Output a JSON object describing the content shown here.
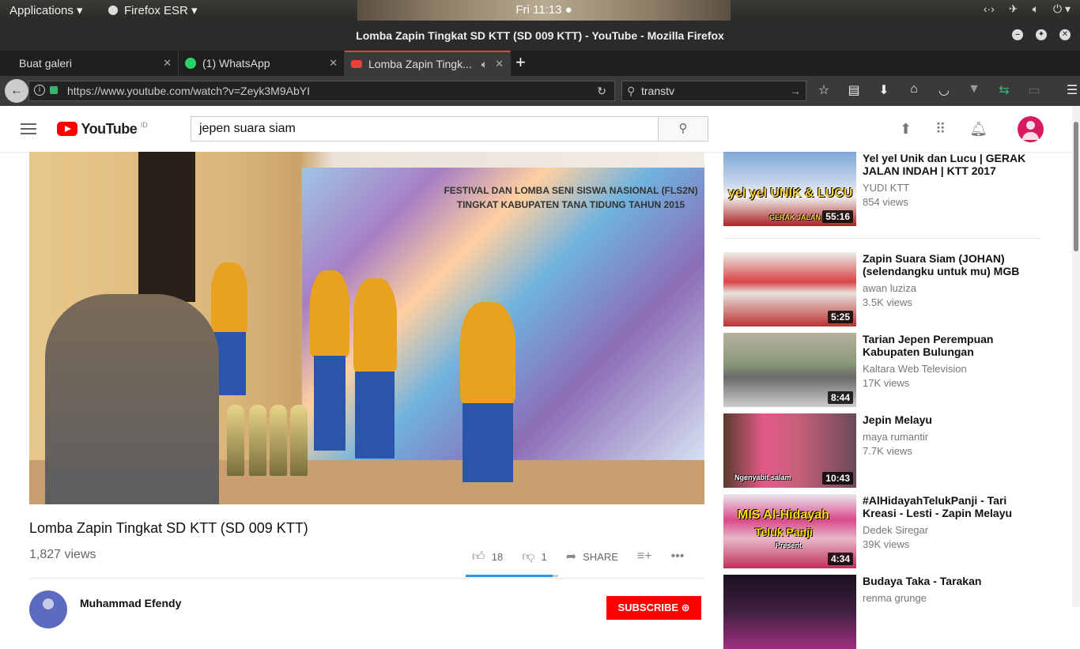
{
  "desktop": {
    "applications": "Applications",
    "app_name": "Firefox ESR",
    "clock": "Fri 11:13"
  },
  "window": {
    "title": "Lomba Zapin Tingkat SD KTT (SD 009 KTT) - YouTube - Mozilla Firefox"
  },
  "tabs": [
    {
      "label": "Buat galeri"
    },
    {
      "label": "(1) WhatsApp"
    },
    {
      "label": "Lomba Zapin Tingk..."
    }
  ],
  "nav": {
    "url": "https://www.youtube.com/watch?v=Zeyk3M9AbYI",
    "search_value": "transtv"
  },
  "youtube": {
    "logo": "YouTube",
    "region": "ID",
    "search_query": "jepen suara siam"
  },
  "video": {
    "banner_text": "FESTIVAL DAN LOMBA SENI SISWA NASIONAL (FLS2N) TINGKAT KABUPATEN TANA TIDUNG TAHUN 2015",
    "title": "Lomba Zapin Tingkat SD KTT (SD 009 KTT)",
    "views": "1,827 views",
    "likes": "18",
    "dislikes": "1",
    "like_ratio": 0.94,
    "share": "SHARE",
    "channel": "Muhammad Efendy",
    "subscribe": "SUBSCRIBE"
  },
  "recommendations": [
    {
      "title": "Yel yel Unik dan Lucu | GERAK JALAN INDAH | KTT 2017",
      "channel": "YUDI KTT",
      "views": "854 views",
      "duration": "55:16",
      "overlay": "yel yel UNIK & LUCU",
      "overlay2": "GERAK JALAN IN"
    },
    {
      "title": "Zapin Suara Siam (JOHAN) (selendangku untuk mu) MGB",
      "channel": "awan luziza",
      "views": "3.5K views",
      "duration": "5:25"
    },
    {
      "title": "Tarian Jepen Perempuan Kabupaten Bulungan",
      "channel": "Kaltara Web Television",
      "views": "17K views",
      "duration": "8:44"
    },
    {
      "title": "Jepin Melayu",
      "channel": "maya rumantir",
      "views": "7.7K views",
      "duration": "10:43",
      "overlay": "Ngenyabit salam"
    },
    {
      "title": "#AlHidayahTelukPanji - Tari Kreasi - Lesti - Zapin Melayu",
      "channel": "Dedek Siregar",
      "views": "39K views",
      "duration": "4:34",
      "overlay": "MIS Al-Hidayah",
      "overlay2": "Teluk Panji",
      "overlay3": "Present"
    },
    {
      "title": "Budaya Taka - Tarakan",
      "channel": "renma grunge",
      "views": "",
      "duration": ""
    }
  ]
}
